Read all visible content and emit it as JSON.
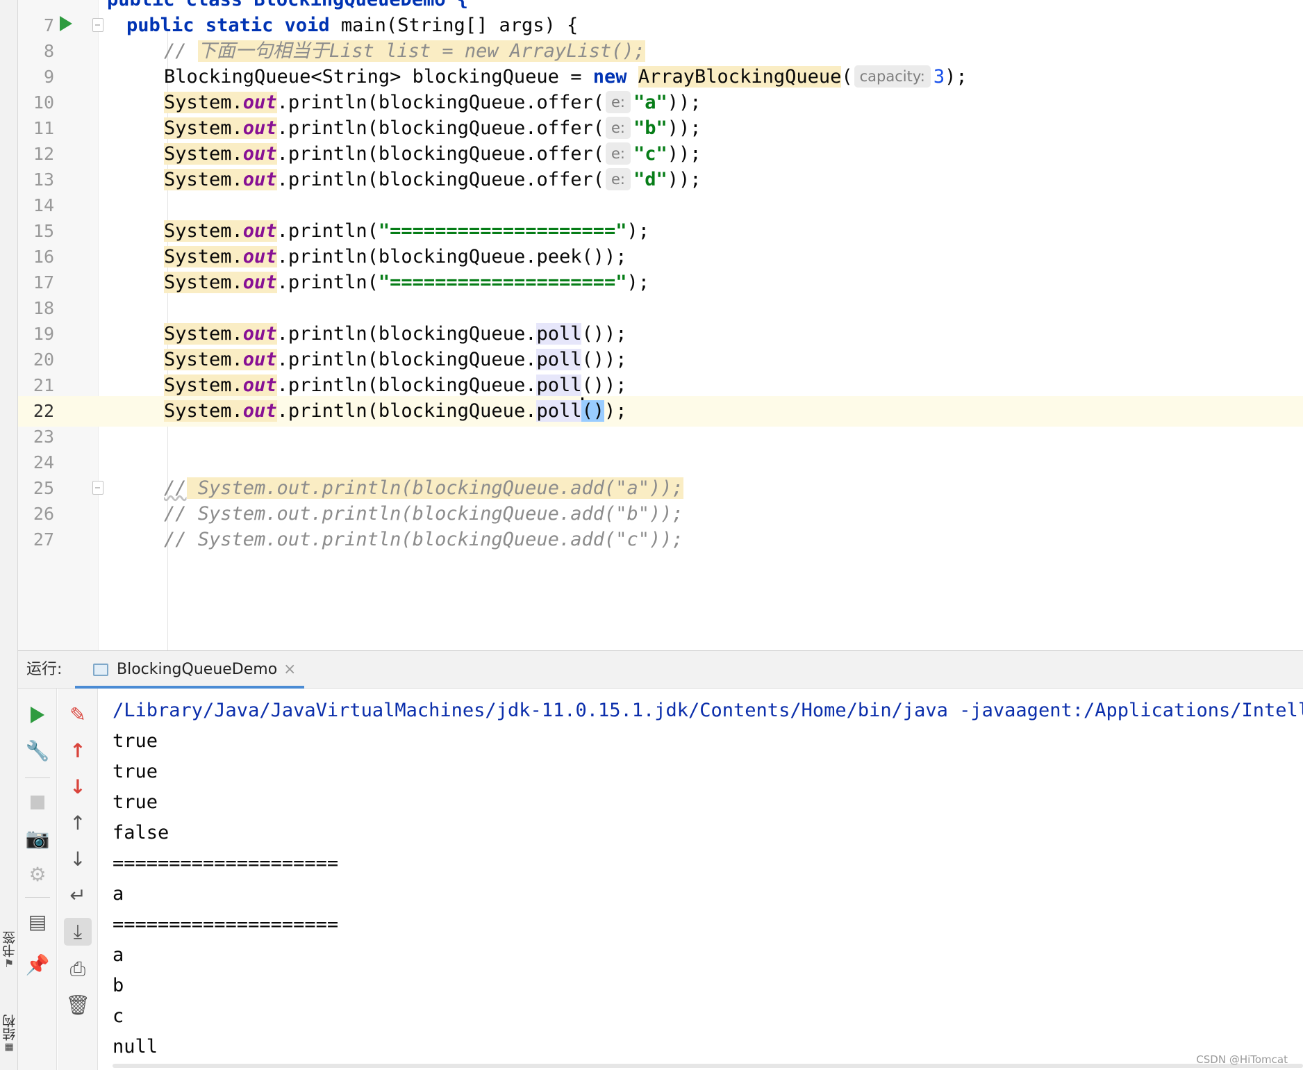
{
  "side_panel": {
    "bookmarks_label": "书签",
    "structure_label": "结构"
  },
  "editor": {
    "top_partial_line": "public class BlockingQueueDemo {",
    "lines": {
      "l7": {
        "num": "7",
        "kw1": "public",
        "kw2": "static",
        "kw3": "void",
        "rest": " main(String[] args) {"
      },
      "l8": {
        "num": "8",
        "prefix": "// ",
        "comment": "下面一句相当于List list = new ArrayList();"
      },
      "l9": {
        "num": "9",
        "decl": "BlockingQueue<String> blockingQueue = ",
        "kw": "new",
        "ctor": "ArrayBlockingQueue",
        "open": "(",
        "hint": "capacity:",
        "arg": "3",
        "close": ");"
      },
      "l10": {
        "num": "10",
        "sys": "System.",
        "out": "out",
        "call": ".println(blockingQueue.offer(",
        "hint": "e:",
        "arg": "\"a\"",
        "close": "));"
      },
      "l11": {
        "num": "11",
        "sys": "System.",
        "out": "out",
        "call": ".println(blockingQueue.offer(",
        "hint": "e:",
        "arg": "\"b\"",
        "close": "));"
      },
      "l12": {
        "num": "12",
        "sys": "System.",
        "out": "out",
        "call": ".println(blockingQueue.offer(",
        "hint": "e:",
        "arg": "\"c\"",
        "close": "));"
      },
      "l13": {
        "num": "13",
        "sys": "System.",
        "out": "out",
        "call": ".println(blockingQueue.offer(",
        "hint": "e:",
        "arg": "\"d\"",
        "close": "));"
      },
      "l14": {
        "num": "14"
      },
      "l15": {
        "num": "15",
        "sys": "System.",
        "out": "out",
        "call": ".println(",
        "arg": "\"====================\"",
        "close": ");"
      },
      "l16": {
        "num": "16",
        "sys": "System.",
        "out": "out",
        "call": ".println(blockingQueue.peek());"
      },
      "l17": {
        "num": "17",
        "sys": "System.",
        "out": "out",
        "call": ".println(",
        "arg": "\"====================\"",
        "close": ");"
      },
      "l18": {
        "num": "18"
      },
      "l19": {
        "num": "19",
        "sys": "System.",
        "out": "out",
        "call": ".println(blockingQueue.",
        "method": "poll",
        "close": "());"
      },
      "l20": {
        "num": "20",
        "sys": "System.",
        "out": "out",
        "call": ".println(blockingQueue.",
        "method": "poll",
        "close": "());"
      },
      "l21": {
        "num": "21",
        "sys": "System.",
        "out": "out",
        "call": ".println(blockingQueue.",
        "method": "poll",
        "close": "());"
      },
      "l22": {
        "num": "22",
        "sys": "System.",
        "out": "out",
        "call": ".println(blockingQueue.",
        "method": "poll",
        "parens": "()",
        "close": ");"
      },
      "l23": {
        "num": "23"
      },
      "l24": {
        "num": "24"
      },
      "l25": {
        "num": "25",
        "prefix": "//",
        "comment": " System.out.println(blockingQueue.add(\"a\"));"
      },
      "l26": {
        "num": "26",
        "text": "// System.out.println(blockingQueue.add(\"b\"));"
      },
      "l27": {
        "num": "27",
        "text": "// System.out.println(blockingQueue.add(\"c\"));"
      }
    }
  },
  "run_panel": {
    "label": "运行:",
    "tab_title": "BlockingQueueDemo",
    "tab_close": "×",
    "console_lines": [
      "/Library/Java/JavaVirtualMachines/jdk-11.0.15.1.jdk/Contents/Home/bin/java -javaagent:/Applications/Intelli",
      "true",
      "true",
      "true",
      "false",
      "====================",
      "a",
      "====================",
      "a",
      "b",
      "c",
      "null"
    ]
  },
  "watermark": "CSDN @HiTomcat",
  "colors": {
    "keyword": "#0033b3",
    "string": "#067d17",
    "static_field": "#871094",
    "comment": "#8c8c8c",
    "usage_highlight": "#faedc4",
    "current_line": "#fefbe8",
    "run_green": "#2e9b3f",
    "console_command": "#0b2eab"
  }
}
